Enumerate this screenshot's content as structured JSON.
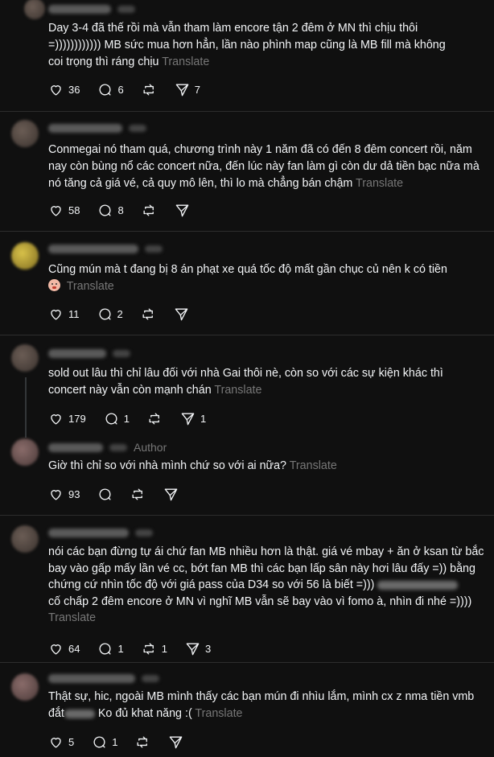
{
  "translate_label": "Translate",
  "author_label": "Author",
  "posts": [
    {
      "text_a": "Day 3-4 đã thế rồi mà vẫn tham làm encore tận 2 đêm ở MN thì chịu thôi =)))))))))))) MB sức mua hơn hẳn, lần nào phình map cũng là MB fill mà không coi trọng thì ráng chịu",
      "likes": "36",
      "comments": "6",
      "shares": "7"
    },
    {
      "text_a": "Conmegai nó tham quá, chương trình này 1 năm đã có đến 8 đêm concert rồi, năm nay còn bùng nổ các concert nữa, đến lúc này fan làm gì còn dư dả tiền bạc nữa mà nó tăng cả giá vé, cả quy mô lên, thì lo mà chẳng bán chậm",
      "likes": "58",
      "comments": "8"
    },
    {
      "text_a": "Cũng mún mà t đang bị 8 án phạt xe quá tốc độ mất gần chục củ nên k có tiền",
      "likes": "11",
      "comments": "2"
    },
    {
      "text_a": "sold out lâu thì chỉ lâu đối với nhà Gai thôi nè, còn so với các sự kiện khác thì concert này vẫn còn mạnh chán",
      "likes": "179",
      "comments": "1",
      "shares": "1"
    },
    {
      "text_a": "Giờ thì chỉ so với nhà mình chứ so với ai nữa?",
      "likes": "93"
    },
    {
      "text_a": "nói các bạn đừng tự ái chứ fan MB nhiều hơn là thật. giá vé mbay + ăn ở ksan từ bắc bay vào gấp mấy lần vé cc, bớt fan MB thì các bạn lấp sân này hơi lâu đấy =)) bằng chứng cứ nhìn tốc độ với giá pass của D34 so với 56 là biết =)))",
      "text_b": "cố chấp 2 đêm encore ở MN vì nghĩ MB vẫn sẽ bay vào vì fomo à, nhìn đi nhé =))))",
      "likes": "64",
      "comments": "1",
      "reposts": "1",
      "shares": "3"
    },
    {
      "text_a": "Thật sự, hic, ngoài MB mình thấy các bạn mún đi nhìu lắm, mình cx z nma tiền vmb đắt",
      "text_b": "Ko đủ khat năng :(",
      "likes": "5",
      "comments": "1"
    }
  ]
}
